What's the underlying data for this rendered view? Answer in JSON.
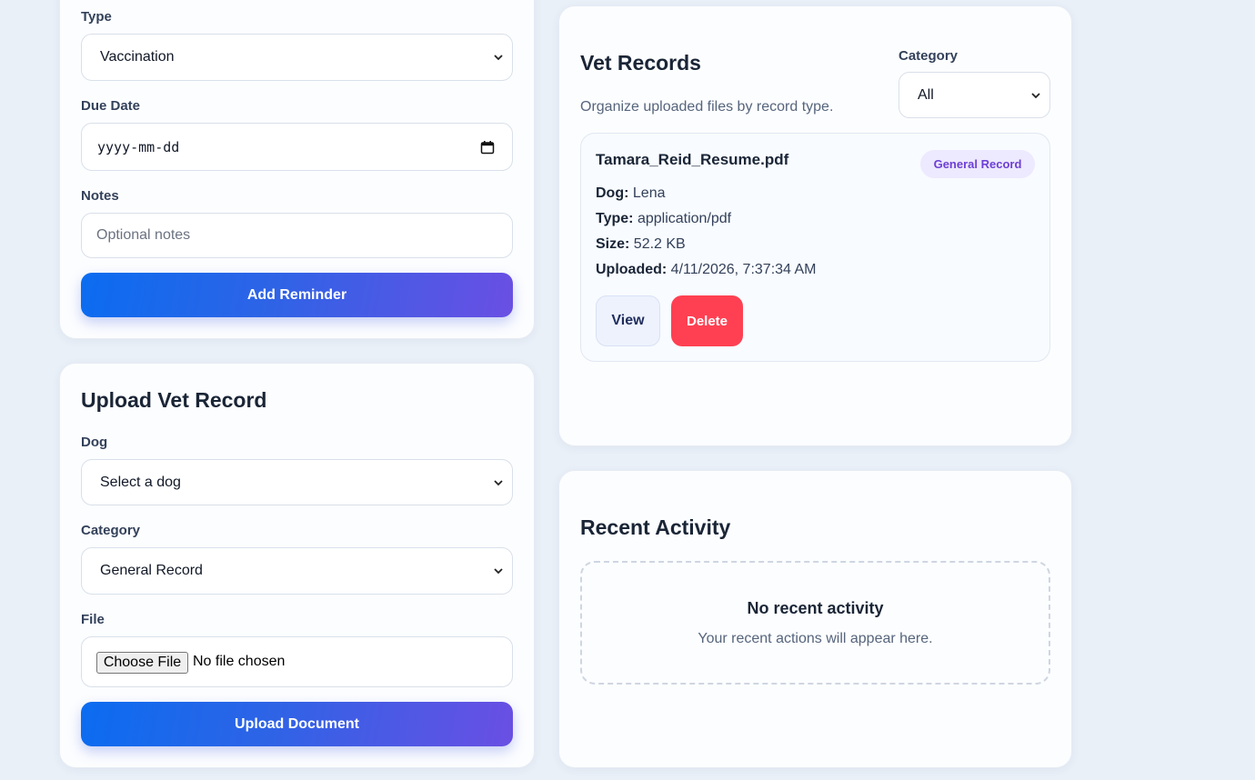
{
  "reminder_form": {
    "type_label": "Type",
    "type_value": "Vaccination",
    "due_date_label": "Due Date",
    "due_date_placeholder": "yyyy-mm-dd",
    "notes_label": "Notes",
    "notes_placeholder": "Optional notes",
    "submit_label": "Add Reminder"
  },
  "upload_form": {
    "title": "Upload Vet Record",
    "dog_label": "Dog",
    "dog_value": "Select a dog",
    "category_label": "Category",
    "category_value": "General Record",
    "file_label": "File",
    "choose_file_label": "Choose File",
    "file_status": "No file chosen",
    "submit_label": "Upload Document"
  },
  "vet_records": {
    "title": "Vet Records",
    "subtitle": "Organize uploaded files by record type.",
    "filter_label": "Category",
    "filter_value": "All",
    "records": [
      {
        "filename": "Tamara_Reid_Resume.pdf",
        "badge": "General Record",
        "dog_label": "Dog:",
        "dog": "Lena",
        "type_label": "Type:",
        "type": "application/pdf",
        "size_label": "Size:",
        "size": "52.2 KB",
        "uploaded_label": "Uploaded:",
        "uploaded": "4/11/2026, 7:37:34 AM",
        "view_label": "View",
        "delete_label": "Delete"
      }
    ]
  },
  "recent_activity": {
    "title": "Recent Activity",
    "empty_title": "No recent activity",
    "empty_text": "Your recent actions will appear here."
  },
  "colors": {
    "background": "#eaf0f8",
    "primary_gradient_start": "#0b6cf0",
    "primary_gradient_end": "#6a4fe3",
    "delete": "#ff4052",
    "badge_bg": "#ede9fe",
    "badge_text": "#6d3fd6"
  },
  "icons": {
    "select_chevron": "chevron-down-icon",
    "date_picker": "calendar-icon"
  }
}
